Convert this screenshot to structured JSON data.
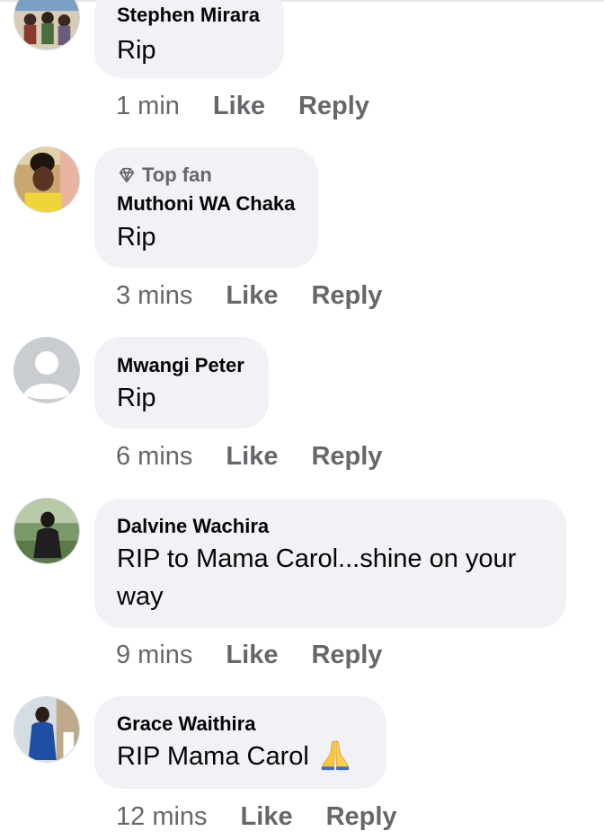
{
  "comments": [
    {
      "author": "Stephen Mirara",
      "badge": "",
      "text": "Rip",
      "time": "1 min",
      "like": "Like",
      "reply": "Reply"
    },
    {
      "author": "Muthoni WA Chaka",
      "badge": "Top fan",
      "text": "Rip",
      "time": "3 mins",
      "like": "Like",
      "reply": "Reply"
    },
    {
      "author": "Mwangi Peter",
      "badge": "",
      "text": "Rip",
      "time": "6 mins",
      "like": "Like",
      "reply": "Reply"
    },
    {
      "author": "Dalvine Wachira",
      "badge": "",
      "text_line1": "RIP to Mama Carol...shine on your",
      "text_line2": "way",
      "time": "9 mins",
      "like": "Like",
      "reply": "Reply"
    },
    {
      "author": "Grace Waithira",
      "badge": "",
      "text": "RIP Mama Carol",
      "emoji": "folded-hands-emoji",
      "time": "12 mins",
      "like": "Like",
      "reply": "Reply"
    }
  ],
  "icons": {
    "top_fan": "diamond-icon",
    "default_avatar": "default-avatar-icon"
  },
  "colors": {
    "bubble": "#f0f2f5",
    "muted_text": "#65676b",
    "text": "#050505"
  }
}
